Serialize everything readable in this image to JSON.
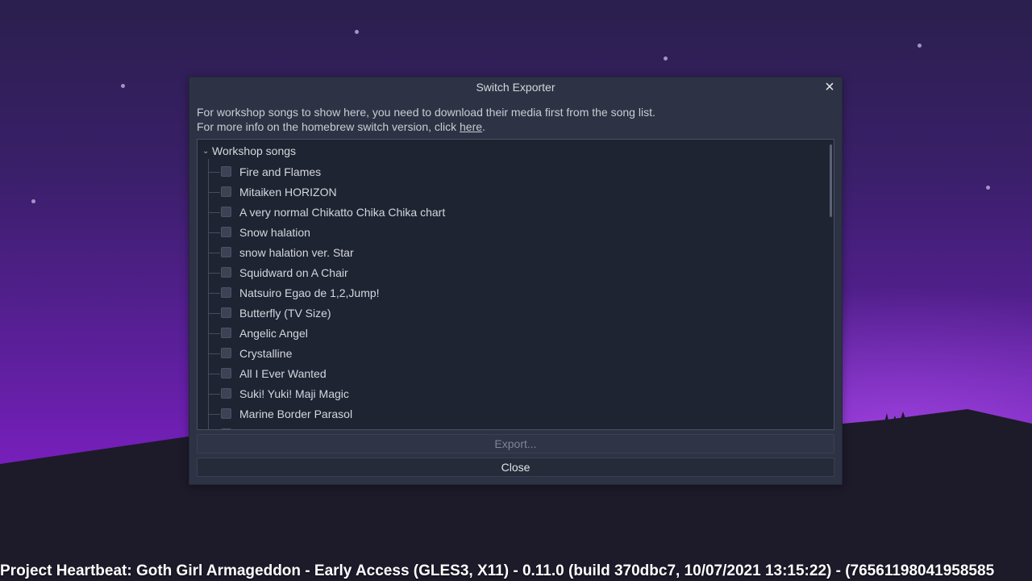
{
  "dialog": {
    "title": "Switch Exporter",
    "close_icon": "×",
    "info_line1": "For workshop songs to show here, you need to download their media first from the song list.",
    "info_line2_prefix": "For more info on the homebrew switch version, click ",
    "info_link": "here",
    "info_line2_suffix": ".",
    "tree_root": "Workshop songs",
    "songs": [
      "Fire and Flames",
      "Mitaiken HORIZON",
      "A very normal Chikatto Chika Chika chart",
      "Snow halation",
      "snow halation ver. Star",
      "Squidward on A Chair",
      "Natsuiro Egao de 1,2,Jump!",
      "Butterfly (TV Size)",
      "Angelic Angel",
      "Crystalline",
      "All I Ever Wanted",
      "Suki! Yuki! Maji Magic",
      "Marine Border Parasol",
      "Void Taste"
    ],
    "export_label": "Export...",
    "close_label": "Close"
  },
  "window": {
    "status_text": "Project Heartbeat: Goth Girl Armageddon - Early Access (GLES3, X11) - 0.11.0 (build 370dbc7, 10/07/2021  13:15:22) - (76561198041958585"
  },
  "colors": {
    "dialog_bg": "#2d3344",
    "tree_bg": "#1f2432",
    "sky_accent": "#7a1fbf"
  }
}
